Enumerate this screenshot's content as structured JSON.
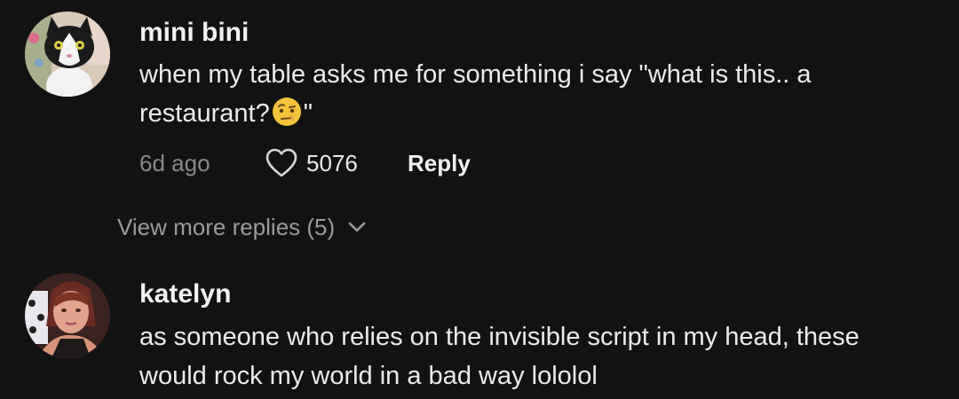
{
  "comments": [
    {
      "username": "mini bini",
      "avatar_icon": "cat-avatar-icon",
      "text_line1": "when my table asks me for something i say \"what is this.. a",
      "text_line2_before": "restaurant?",
      "text_emoji": "raised-eyebrow-emoji",
      "text_line2_after": "\"",
      "time": "6d ago",
      "like_icon": "heart-icon",
      "like_count": "5076",
      "reply_label": "Reply"
    },
    {
      "username": "katelyn",
      "avatar_icon": "profile-photo-avatar",
      "text_line1": "as someone who relies on the invisible script in my head, these",
      "text_line2": "would rock my world in a bad way lololol"
    }
  ],
  "view_more": {
    "label": "View more replies (5)",
    "icon": "chevron-down-icon"
  },
  "colors": {
    "background": "#121212",
    "primary_text": "#f1f1f1",
    "secondary_text": "#8a8a8a"
  }
}
